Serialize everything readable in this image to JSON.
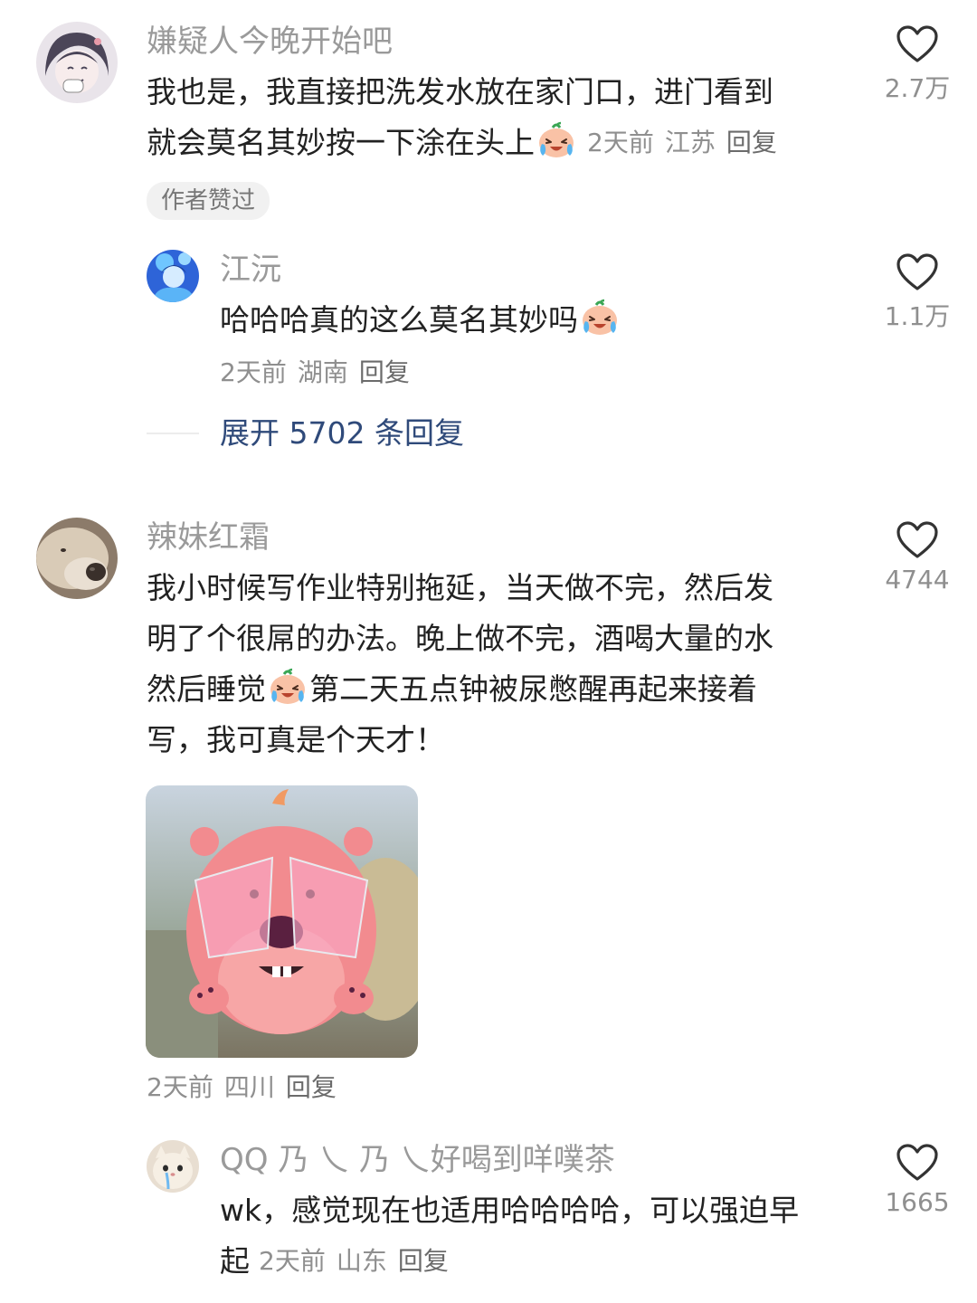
{
  "comments": [
    {
      "username": "嫌疑人今晚开始吧",
      "text_lines": [
        "我也是，我直接把洗发水放在家门口，进门看到",
        "就会莫名其妙按一下涂在头上"
      ],
      "time": "2天前",
      "location": "江苏",
      "reply_label": "回复",
      "likes": "2.7万",
      "badge": "作者赞过",
      "replies": [
        {
          "username": "江沅",
          "text": "哈哈哈真的这么莫名其妙吗",
          "time": "2天前",
          "location": "湖南",
          "reply_label": "回复",
          "likes": "1.1万"
        }
      ],
      "expand_label": "展开 5702 条回复"
    },
    {
      "username": "辣妹红霜",
      "text_lines": [
        "我小时候写作业特别拖延，当天做不完，然后发",
        "明了个很屌的办法。晚上做不完，酒喝大量的水",
        "然后睡觉",
        "第二天五点钟被尿憋醒再起来接着",
        "写，我可真是个天才！"
      ],
      "time": "2天前",
      "location": "四川",
      "reply_label": "回复",
      "likes": "4744",
      "sticker": "pink-beaver-sticker",
      "replies": [
        {
          "username": "QQ 乃 乀 乃 乀好喝到咩噗茶",
          "text_lines": [
            "wk，感觉现在也适用哈哈哈哈，可以强迫早",
            "起"
          ],
          "time": "2天前",
          "location": "山东",
          "reply_label": "回复",
          "likes": "1665"
        }
      ]
    }
  ],
  "icons": {
    "like": "heart-outline-icon",
    "emoji": "laugh-cry-emoji-icon"
  }
}
